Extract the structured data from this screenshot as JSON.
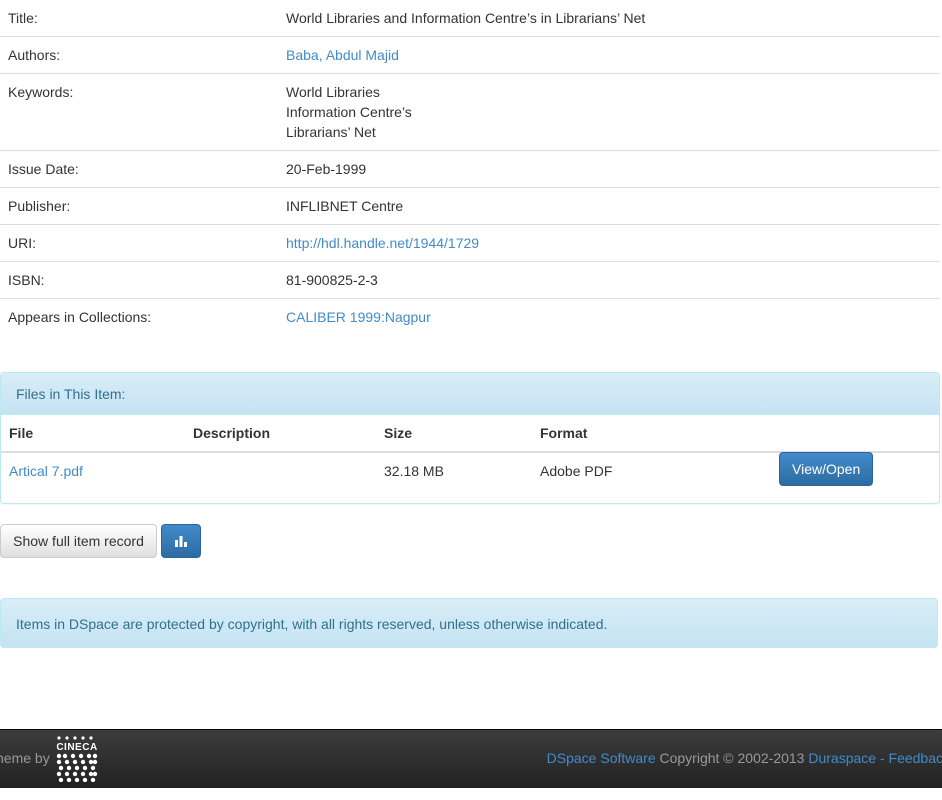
{
  "metadata": {
    "title_label": "Title:",
    "title_value": "World Libraries and Information Centre’s in Librarians’ Net",
    "authors_label": "Authors:",
    "authors_value": "Baba, Abdul Majid",
    "keywords_label": "Keywords:",
    "keywords": [
      "World Libraries",
      "Information Centre’s",
      "Librarians’ Net"
    ],
    "issue_date_label": "Issue Date:",
    "issue_date_value": "20-Feb-1999",
    "publisher_label": "Publisher:",
    "publisher_value": "INFLIBNET Centre",
    "uri_label": "URI:",
    "uri_value": "http://hdl.handle.net/1944/1729",
    "isbn_label": "ISBN:",
    "isbn_value": "81-900825-2-3",
    "collections_label": "Appears in Collections:",
    "collections_value": "CALIBER 1999:Nagpur"
  },
  "files_panel": {
    "heading": "Files in This Item:",
    "columns": [
      "File",
      "Description",
      "Size",
      "Format"
    ],
    "rows": [
      {
        "file": "Artical 7.pdf",
        "description": "",
        "size": "32.18 MB",
        "format": "Adobe PDF",
        "action": "View/Open"
      }
    ]
  },
  "actions": {
    "show_full_record": "Show full item record",
    "stats_icon": "bar-chart-icon"
  },
  "copyright_notice": "Items in DSpace are protected by copyright, with all rights reserved, unless otherwise indicated.",
  "footer": {
    "theme_by": "heme by",
    "logo_text": "CINECA",
    "dspace_link": "DSpace Software",
    "copyright_text": " Copyright © 2002-2013 ",
    "duraspace_link": "Duraspace",
    "separator": " - ",
    "feedback_link": "Feedback"
  },
  "colors": {
    "link": "#428bca",
    "primary": "#428bca",
    "info_bg": "#d9edf7",
    "info_text": "#31708f",
    "footer_bg": "#222222"
  }
}
